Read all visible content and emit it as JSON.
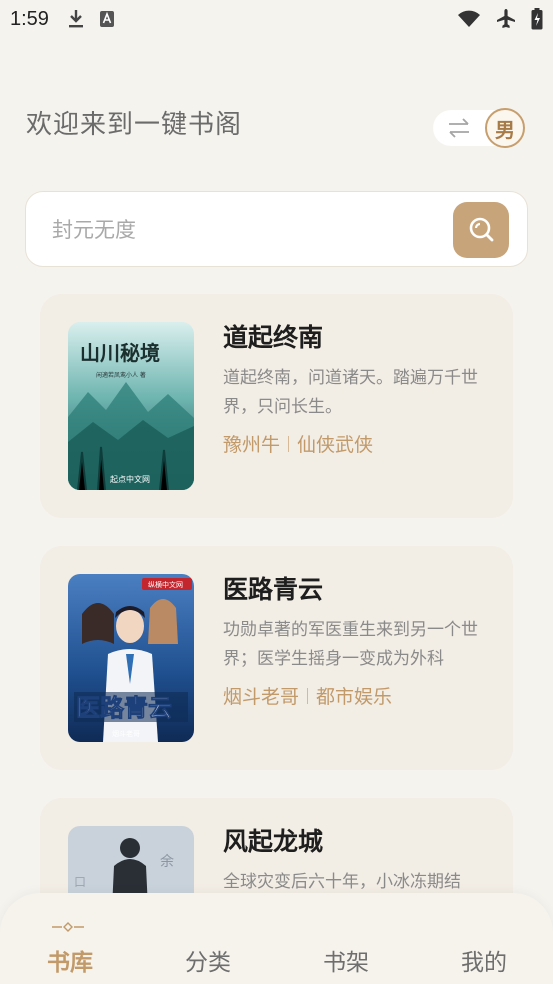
{
  "status_bar": {
    "time": "1:59"
  },
  "header": {
    "title": "欢迎来到一键书阁",
    "gender": "男"
  },
  "search": {
    "placeholder": "封元无度"
  },
  "books": [
    {
      "title": "道起终南",
      "desc": "道起终南，问道诸天。踏遍万千世界，只问长生。",
      "author": "豫州牛",
      "category": "仙侠武侠",
      "cover_title": "山川秘境",
      "cover_small": "闲適若凤鸾小人 著",
      "cover_publisher": "起点中文网"
    },
    {
      "title": "医路青云",
      "desc": "功勋卓著的军医重生来到另一个世界；医学生摇身一变成为外科",
      "author": "烟斗老哥",
      "category": "都市娱乐",
      "cover_title": "医路青云",
      "cover_small": "烟斗老哥",
      "cover_publisher": "纵横中文网"
    },
    {
      "title": "风起龙城",
      "desc": "全球灾变后六十年，小冰冻期结",
      "author": "",
      "category": ""
    }
  ],
  "bottom_nav": [
    {
      "label": "书库",
      "active": true
    },
    {
      "label": "分类",
      "active": false
    },
    {
      "label": "书架",
      "active": false
    },
    {
      "label": "我的",
      "active": false
    }
  ],
  "colors": {
    "accent": "#c8a47a",
    "background": "#f5f3ee",
    "card": "#f2ede5"
  }
}
